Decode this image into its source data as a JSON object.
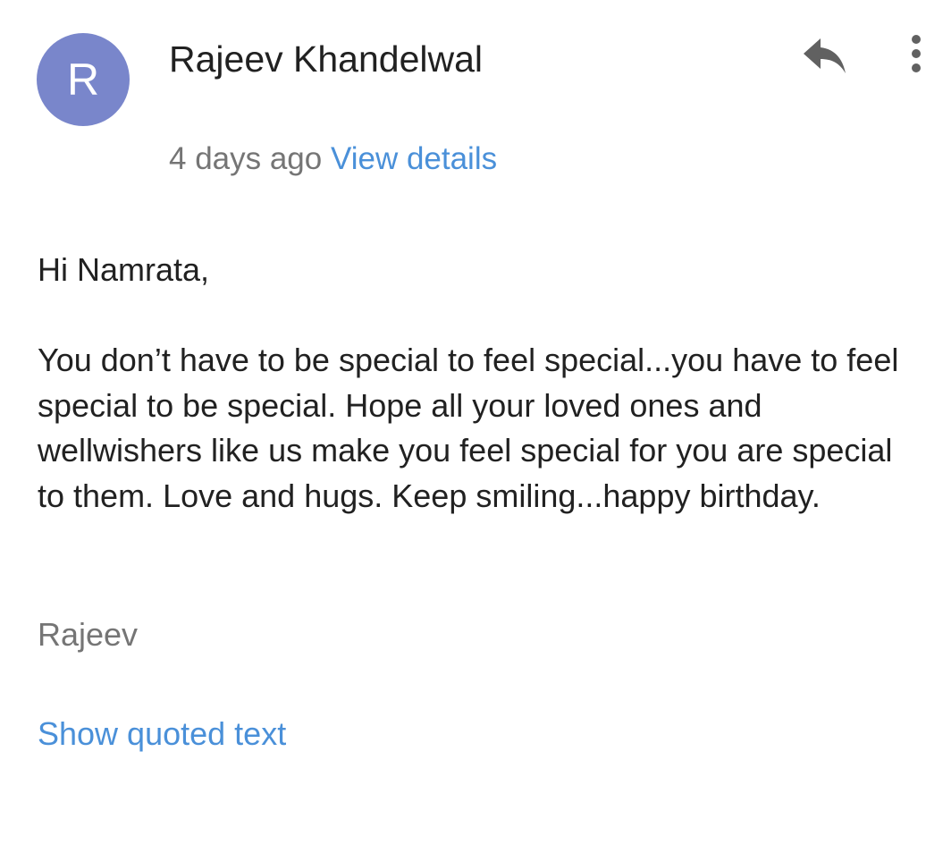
{
  "message": {
    "avatar_letter": "R",
    "avatar_color": "#7986cb",
    "sender_name": "Rajeev Khandelwal",
    "timestamp": "4 days ago",
    "view_details_label": "View details",
    "greeting": "Hi Namrata,",
    "body": "You don’t have to be special to feel special...you have to feel special to be special. Hope all your loved ones and wellwishers like us make you feel special for you are special to them. Love and hugs. Keep smiling...happy birthday.",
    "signature": "Rajeev",
    "show_quoted_label": "Show quoted text",
    "link_color": "#4a90d9"
  },
  "actions": {
    "reply_icon": "reply-icon",
    "more_icon": "more-vert-icon"
  }
}
